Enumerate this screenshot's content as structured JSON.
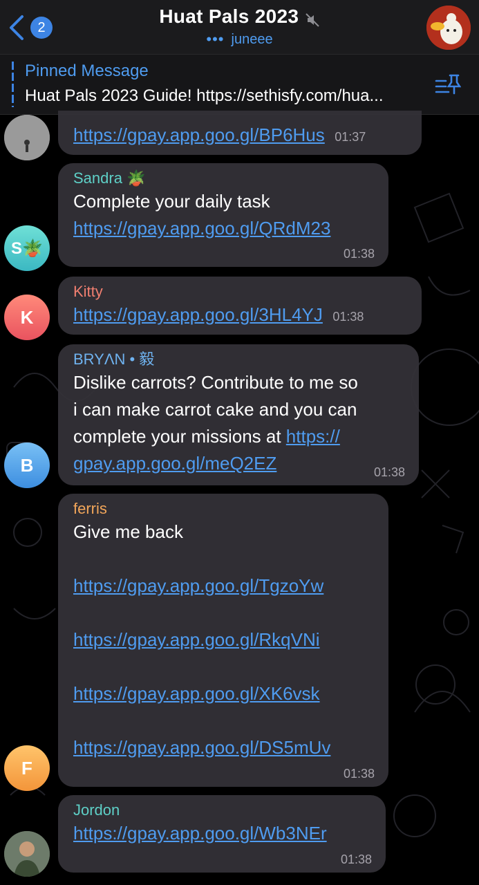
{
  "header": {
    "unread_count": "2",
    "title": "Huat Pals 2023",
    "typing_dots": "•••",
    "typing_user": "juneee"
  },
  "pinned": {
    "label": "Pinned Message",
    "text": "Huat Pals 2023 Guide! https://sethisfy.com/hua..."
  },
  "colors": {
    "accent": "#4f9cf0",
    "bubble": "#343238",
    "header_bg": "#1b1b1d"
  },
  "messages": [
    {
      "sender": "",
      "links": [
        "https://gpay.app.goo.gl/BP6Hus"
      ],
      "time": "01:37"
    },
    {
      "sender": "Sandra 🪴",
      "sender_color": "#5ed0c7",
      "avatar_initial": "S🪴",
      "text": "Complete your daily task",
      "links": [
        "https://gpay.app.goo.gl/QRdM23"
      ],
      "time": "01:38"
    },
    {
      "sender": "Kitty",
      "sender_color": "#f07f70",
      "avatar_initial": "K",
      "links": [
        "https://gpay.app.goo.gl/3HL4YJ"
      ],
      "time": "01:38"
    },
    {
      "sender": "BRYΛN • 毅",
      "sender_color": "#6fb3f0",
      "avatar_initial": "B",
      "text": "Dislike carrots? Contribute to me so\ni can make carrot cake and you can\ncomplete your missions at ",
      "link_part1": "https://",
      "link_part2": "gpay.app.goo.gl/meQ2EZ",
      "time": "01:38"
    },
    {
      "sender": "ferris",
      "sender_color": "#f2a65a",
      "avatar_initial": "F",
      "text": "Give me back",
      "links": [
        "https://gpay.app.goo.gl/TgzoYw",
        "https://gpay.app.goo.gl/RkqVNi",
        "https://gpay.app.goo.gl/XK6vsk",
        "https://gpay.app.goo.gl/DS5mUv"
      ],
      "time": "01:38"
    },
    {
      "sender": "Jordon",
      "sender_color": "#5ed0c7",
      "links": [
        "https://gpay.app.goo.gl/Wb3NEr"
      ],
      "time": "01:38"
    }
  ]
}
